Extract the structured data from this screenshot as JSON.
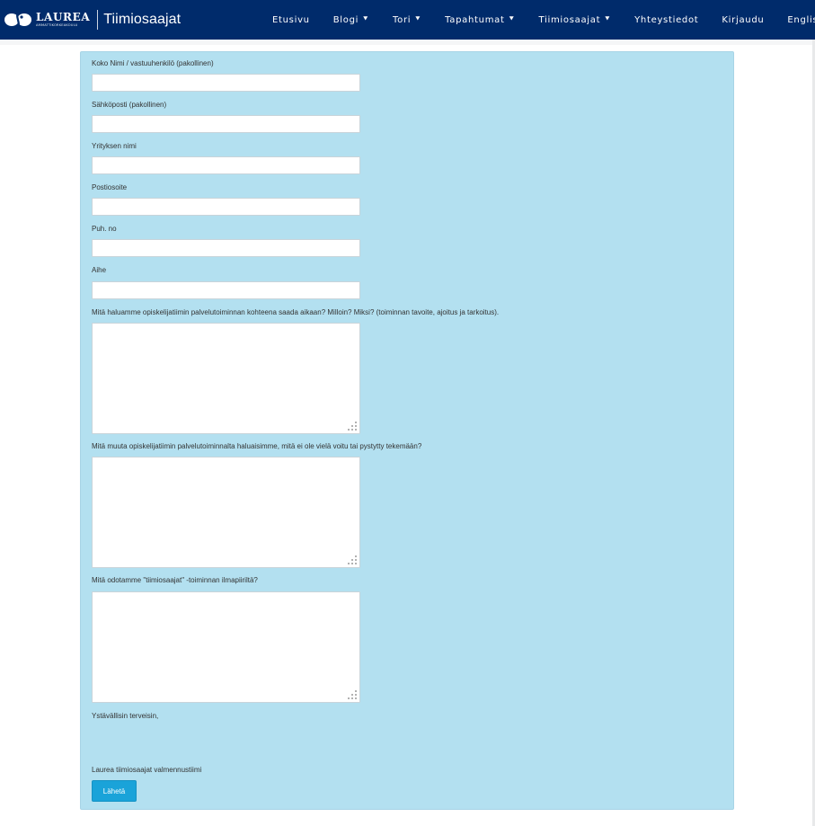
{
  "brand": {
    "logo_word": "LAUREA",
    "logo_sub": "AMMATTIKORKEAKOULU",
    "title": "Tiimiosaajat"
  },
  "nav": {
    "items": [
      {
        "label": "Etusivu",
        "has_dropdown": false
      },
      {
        "label": "Blogi",
        "has_dropdown": true
      },
      {
        "label": "Tori",
        "has_dropdown": true
      },
      {
        "label": "Tapahtumat",
        "has_dropdown": true
      },
      {
        "label": "Tiimiosaajat",
        "has_dropdown": true
      },
      {
        "label": "Yhteystiedot",
        "has_dropdown": false
      },
      {
        "label": "Kirjaudu",
        "has_dropdown": false
      },
      {
        "label": "English",
        "has_dropdown": false
      }
    ],
    "dropdown_glyph": "»"
  },
  "form": {
    "fields": [
      {
        "label": "Koko Nimi / vastuuhenkilö (pakollinen)",
        "value": ""
      },
      {
        "label": "Sähköposti (pakollinen)",
        "value": ""
      },
      {
        "label": "Yrityksen nimi",
        "value": ""
      },
      {
        "label": "Postiosoite",
        "value": ""
      },
      {
        "label": "Puh. no",
        "value": ""
      },
      {
        "label": "Aihe",
        "value": ""
      }
    ],
    "textareas": [
      {
        "label": "Mitä haluamme opiskelijatiimin palvelutoiminnan kohteena saada aikaan? Milloin? Miksi? (toiminnan tavoite, ajoitus ja tarkoitus).",
        "value": ""
      },
      {
        "label": "Mitä muuta opiskelijatiimin palvelutoiminnalta haluaisimme, mitä ei ole vielä voitu tai pystytty tekemään?",
        "value": ""
      },
      {
        "label": "Mitä odotamme \"tiimiosaajat\" -toiminnan ilmapiiriltä?",
        "value": ""
      }
    ],
    "greeting": "Ystävällisin terveisin,",
    "signature": "Laurea tiimiosaajat valmennustiimi",
    "submit_label": "Lähetä"
  },
  "colors": {
    "navbar_bg": "#002b6b",
    "panel_bg": "#b3e0f0",
    "button_bg": "#1aa3d9"
  }
}
